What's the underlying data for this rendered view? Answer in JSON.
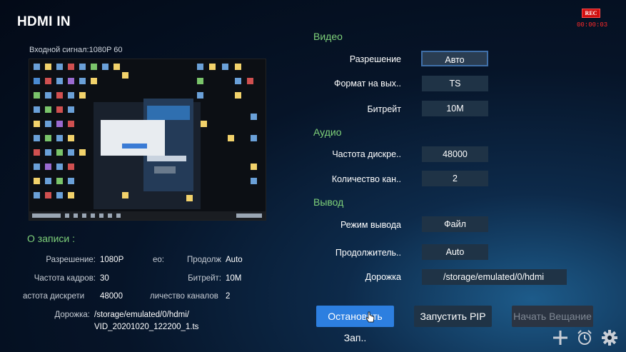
{
  "header": {
    "title": "HDMI IN"
  },
  "rec": {
    "badge": "REC",
    "time": "00:00:03"
  },
  "input_signal": "Входной сигнал:1080P   60",
  "video": {
    "section": "Видео",
    "rows": [
      {
        "label": "Разрешение",
        "value": "Авто"
      },
      {
        "label": "Формат на вых..",
        "value": "TS"
      },
      {
        "label": "Битрейт",
        "value": "10M"
      }
    ]
  },
  "audio": {
    "section": "Аудио",
    "rows": [
      {
        "label": "Частота дискре..",
        "value": "48000"
      },
      {
        "label": "Количество кан..",
        "value": "2"
      }
    ]
  },
  "output": {
    "section": "Вывод",
    "rows": [
      {
        "label": "Режим вывода",
        "value": "Файл"
      },
      {
        "label": "Продолжитель..",
        "value": "Auto"
      },
      {
        "label": "Дорожка",
        "value": "/storage/emulated/0/hdmi"
      }
    ]
  },
  "recording_info": {
    "title": "О записи :",
    "resolution_label": "Разрешение:",
    "resolution_value": "1080P",
    "truncated_label_1": "ео:",
    "duration_label": "Продолж",
    "duration_value": "Auto",
    "framerate_label": "Частота кадров:",
    "framerate_value": "30",
    "bitrate_label": "Битрейт:",
    "bitrate_value": "10M",
    "samplerate_label": "астота дискрети",
    "samplerate_value": "48000",
    "channels_label": "личество каналов",
    "channels_value": "2",
    "track_label": "Дорожка:",
    "track_value_1": "/storage/emulated/0/hdmi/",
    "track_value_2": "VID_20201020_122200_1.ts"
  },
  "buttons": {
    "stop": "Остановить Зап..",
    "pip": "Запустить PIP",
    "broadcast": "Начать Вещание"
  },
  "icons": [
    "plus-icon",
    "alarm-clock-icon",
    "gear-icon",
    "mouse-cursor-icon"
  ]
}
